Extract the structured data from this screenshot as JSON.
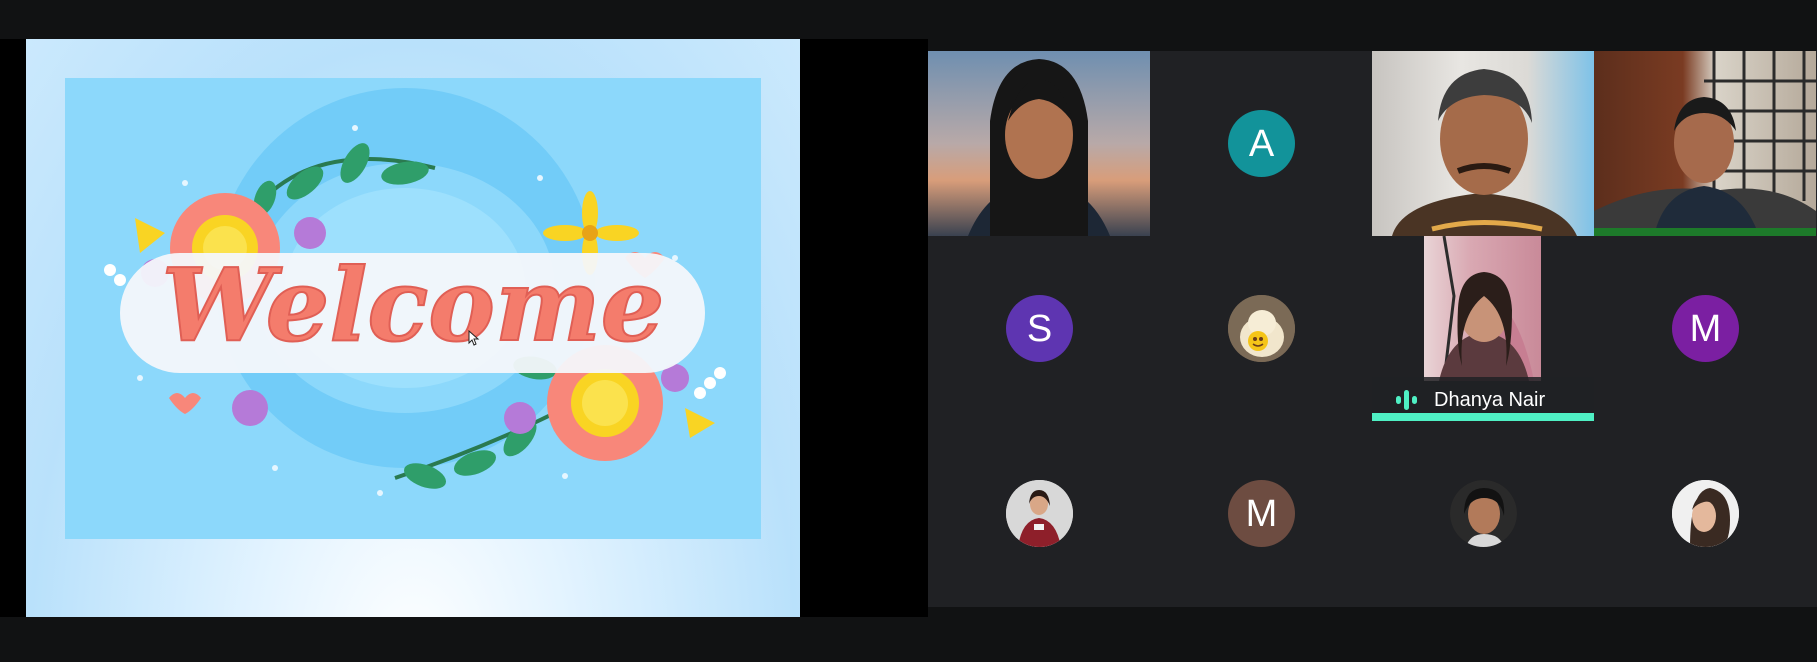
{
  "participants": [
    {
      "id": "p1",
      "type": "video"
    },
    {
      "id": "p2",
      "type": "initial",
      "initial": "A",
      "color": "#12939a"
    },
    {
      "id": "p3",
      "type": "video"
    },
    {
      "id": "p4",
      "type": "video"
    },
    {
      "id": "p5",
      "type": "initial",
      "initial": "S",
      "color": "#5e35b1"
    },
    {
      "id": "p6",
      "type": "photo"
    },
    {
      "id": "p7",
      "type": "video",
      "name": "Dhanya Nair",
      "speaking": true
    },
    {
      "id": "p8",
      "type": "initial",
      "initial": "M",
      "color": "#7b1fa2"
    },
    {
      "id": "p9",
      "type": "photo"
    },
    {
      "id": "p10",
      "type": "initial",
      "initial": "M",
      "color": "#6d4c41"
    },
    {
      "id": "p11",
      "type": "photo"
    },
    {
      "id": "p12",
      "type": "photo"
    }
  ],
  "slide": {
    "text": "Welcome"
  },
  "colors": {
    "speaking_indicator": "#4ff0c4",
    "grid_bg": "#202124",
    "slide_bg": "#8cd8fb"
  }
}
